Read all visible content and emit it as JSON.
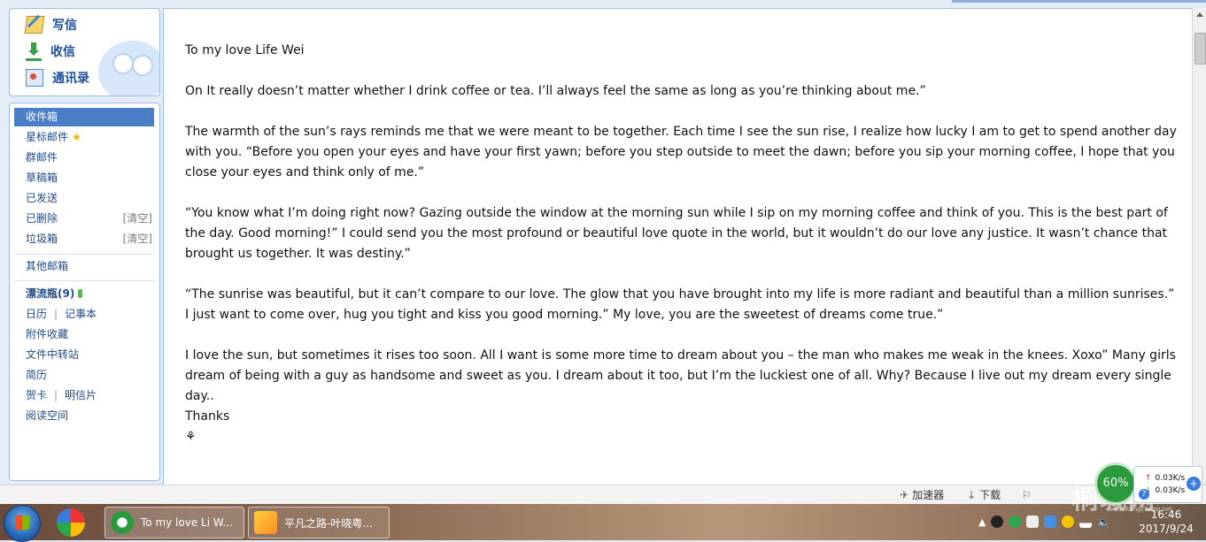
{
  "sidebar": {
    "actions": {
      "compose": "写信",
      "inbox": "收信",
      "contacts": "通讯录"
    },
    "folders": {
      "inbox": "收件箱",
      "starred": "星标邮件",
      "group": "群邮件",
      "drafts": "草稿箱",
      "sent": "已发送",
      "deleted": "已删除",
      "spam": "垃圾箱",
      "clear": "[清空]",
      "other": "其他邮箱",
      "bottle": "漂流瓶(9)",
      "calendar": "日历",
      "notes": "记事本",
      "attachments": "附件收藏",
      "transfer": "文件中转站",
      "resume": "简历",
      "cards": "贺卡",
      "postcards": "明信片",
      "reading": "阅读空间",
      "pipe": "|"
    }
  },
  "letter": {
    "greeting": "To my love Life Wei",
    "p1": "On It really doesn’t matter whether I drink coffee or tea. I’ll always feel the same as long as you’re thinking about me.”",
    "p2": "The warmth of the sun’s rays reminds me that we were meant to be together. Each time I see the sun rise, I realize how lucky I am to get to spend another day with you. “Before you open your eyes and have your first yawn; before you step outside to meet the dawn; before you sip your morning coffee, I hope that you close your eyes and think only of me.”",
    "p3": " “You know what I’m doing right now? Gazing outside the window at the morning sun while I sip on my morning coffee and think of you. This is the best part of the day. Good morning!” I could send you the most profound or beautiful love quote in the world, but it wouldn’t do our love any justice. It wasn’t chance that brought us together. It was destiny.”",
    "p4": "“The sunrise was beautiful, but it can’t compare to our love. The glow that you have brought into my life is more radiant and beautiful than a million sunrises.” I just want to come over, hug you tight and kiss you good morning.” My love, you are the sweetest of dreams come true.”",
    "p5": "I love the sun, but sometimes it rises too soon. All I want is some more time to dream about you – the man who makes me weak in the knees. Xoxo” Many girls dream of being with a guy as handsome and sweet as you. I dream about it too, but I’m the luckiest one of all. Why? Because I live out my dream every single day..",
    "closing": "Thanks",
    "flower": "⚘"
  },
  "statusbar": {
    "accelerator": "加速器",
    "download": "下载"
  },
  "widget": {
    "percent": "60%",
    "upload": "0.03K/s",
    "download": "0.03K/s"
  },
  "watermark": {
    "text": "桐城网",
    "url": "www.itongcheng.net"
  },
  "taskbar": {
    "task1": "To my love Li W...",
    "task2": "平凡之路-叶晓粤...",
    "time": "16:46",
    "date": "2017/9/24"
  },
  "colors": {
    "accent": "#4a7fc7",
    "link": "#1f4a8a",
    "border": "#9fbbe0"
  }
}
